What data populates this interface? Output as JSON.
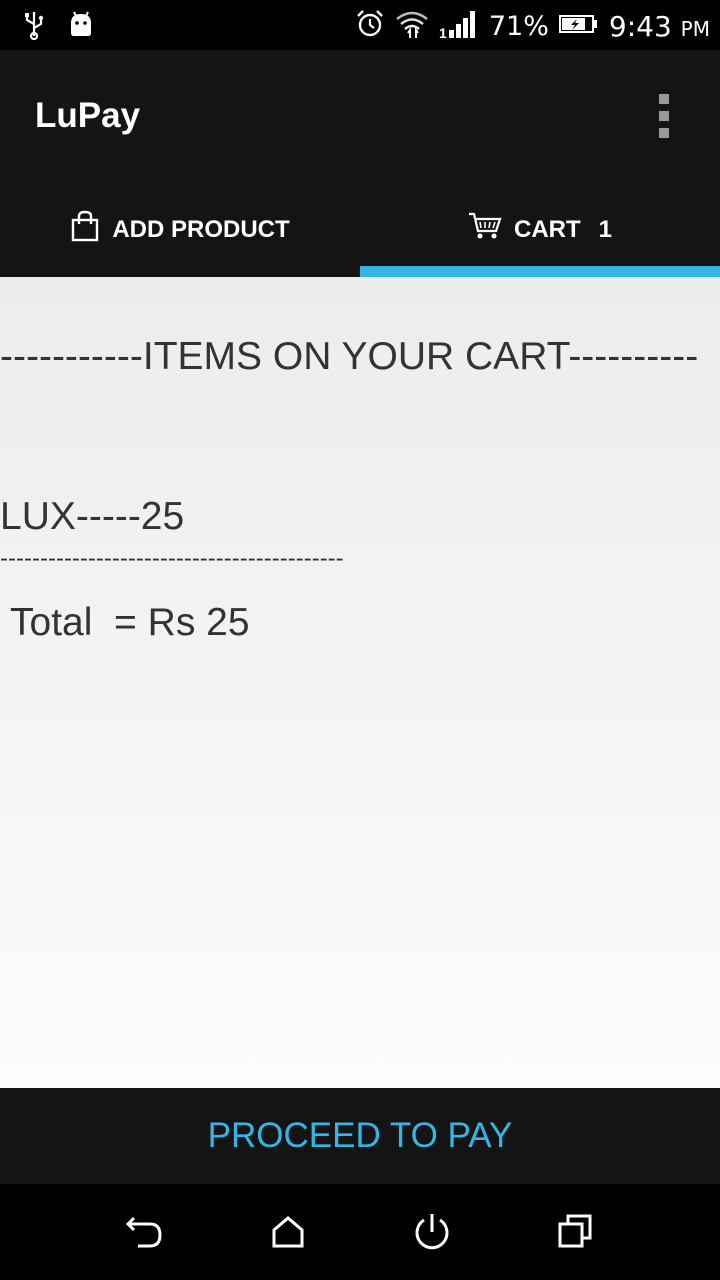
{
  "status_bar": {
    "battery_percent": "71%",
    "time": "9:43",
    "time_suffix": "PM",
    "icons": [
      "usb-icon",
      "android-icon",
      "alarm-icon",
      "wifi-icon",
      "signal-icon",
      "battery-charging-icon"
    ]
  },
  "app": {
    "title": "LuPay"
  },
  "tabs": [
    {
      "label": "ADD PRODUCT",
      "icon": "shopping-bag-icon",
      "selected": false
    },
    {
      "label": "CART",
      "icon": "cart-icon",
      "badge": "1",
      "selected": true
    }
  ],
  "cart": {
    "header": "-----------ITEMS ON YOUR CART----------",
    "items": [
      {
        "text": "LUX-----25"
      }
    ],
    "divider": "-------------------------------------------",
    "total": "Total  = Rs 25"
  },
  "actions": {
    "proceed_label": "PROCEED TO PAY"
  },
  "colors": {
    "accent": "#33b5e5",
    "bar_bg": "#141414",
    "content_text": "#333333"
  }
}
